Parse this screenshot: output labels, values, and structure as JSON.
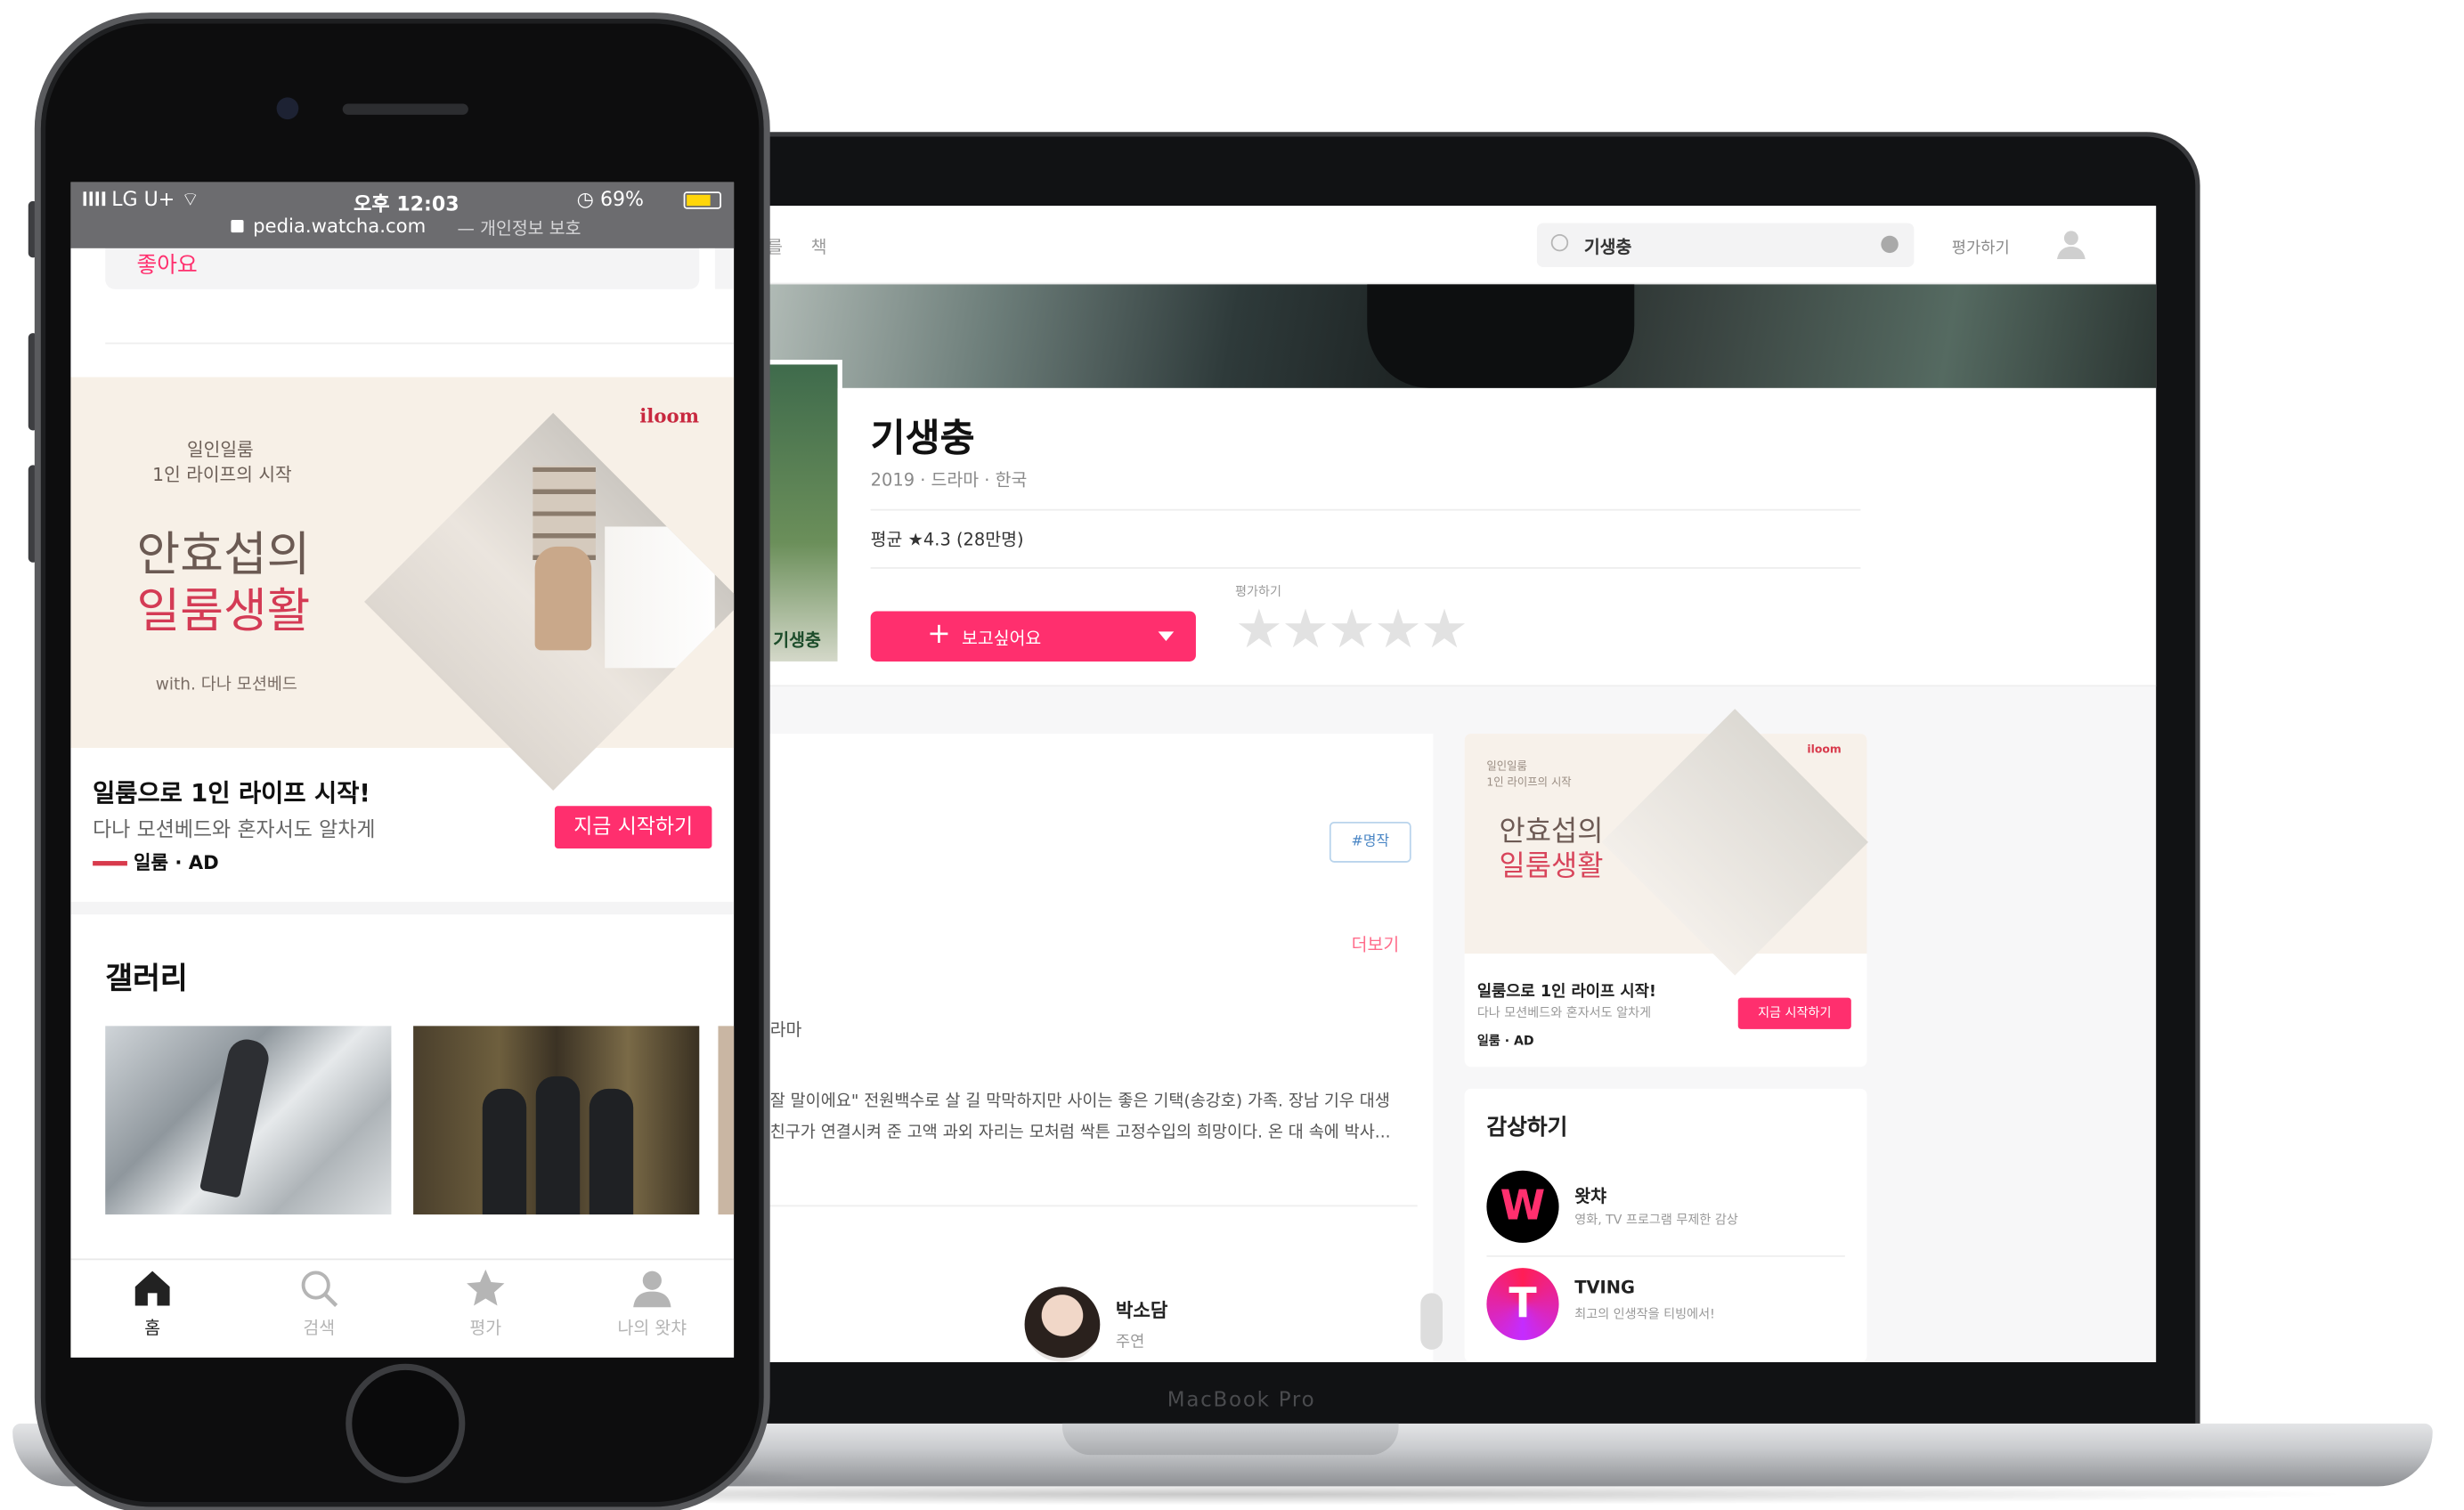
{
  "laptop": {
    "brand_label": "MacBook Pro",
    "topbar": {
      "nav_items": [
        "를",
        "책"
      ],
      "search_value": "기생충",
      "rate_link": "평가하기"
    },
    "movie": {
      "title": "기생충",
      "meta": "2019 · 드라마 · 한국",
      "average": "평균 ★4.3 (28만명)",
      "wish_button": "보고싶어요",
      "rate_label": "평가하기",
      "stars": "★★★★★",
      "poster_text": "기생충"
    },
    "main": {
      "tag": "#명작",
      "more_link": "더보기",
      "genre_text": "라마",
      "description": "잘 말이에요\" 전원백수로 살 길 막막하지만 사이는 좋은 기택(송강호) 가족. 장남 기우 대생 친구가 연결시켜 준 고액 과외 자리는 모처럼 싹튼 고정수입의 희망이다. 온 대 속에 박사...",
      "cast": {
        "name": "박소담",
        "role": "주연"
      }
    },
    "ad": {
      "small_line1": "일인일룸",
      "small_line2": "1인 라이프의 시작",
      "headline1": "안효섭의",
      "headline2": "일룸생활",
      "brand": "iloom",
      "title": "일룸으로 1인 라이프 시작!",
      "subtitle": "다나 모션베드와 혼자서도 알차게",
      "brand_line": "일룸 · AD",
      "cta": "지금 시작하기"
    },
    "watch": {
      "heading": "감상하기",
      "services": [
        {
          "logo": "W",
          "name": "왓챠",
          "desc": "영화, TV 프로그램 무제한 감상"
        },
        {
          "logo": "T",
          "name": "TVING",
          "desc": "최고의 인생작을 티빙에서!"
        }
      ]
    }
  },
  "phone": {
    "status": {
      "carrier": "LG U+",
      "time": "오후 12:03",
      "battery": "69%",
      "battery_level": 0.69,
      "url": "pedia.watcha.com",
      "url_suffix": "— 개인정보 보호"
    },
    "top_card_text": "좋아요",
    "ad": {
      "small_line1": "일인일룸",
      "small_line2": "1인 라이프의 시작",
      "headline1": "안효섭의",
      "headline2": "일룸생활",
      "with_line": "with. 다나 모션베드",
      "brand": "iloom",
      "title": "일룸으로 1인 라이프 시작!",
      "subtitle": "다나 모션베드와 혼자서도 알차게",
      "brand_line": "일룸 · AD",
      "cta": "지금 시작하기"
    },
    "gallery_heading": "갤러리",
    "tabs": [
      {
        "label": "홈",
        "icon": "home-icon",
        "active": true
      },
      {
        "label": "검색",
        "icon": "search-icon",
        "active": false
      },
      {
        "label": "평가",
        "icon": "star-icon",
        "active": false
      },
      {
        "label": "나의 왓챠",
        "icon": "person-icon",
        "active": false
      }
    ]
  },
  "colors": {
    "accent": "#ff2f6e",
    "tab_active": "#222222",
    "tab_inactive": "#b5b5b5"
  }
}
